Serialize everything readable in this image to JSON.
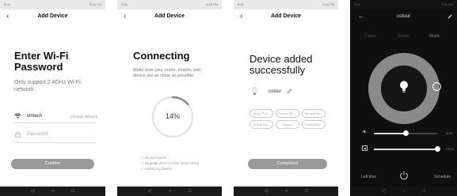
{
  "status_left": "5:26",
  "status_right": "5:26 PM",
  "nav_icons": [
    "◁",
    "○",
    "□"
  ],
  "p1": {
    "title": "Add Device",
    "heading_line1": "Enter Wi-Fi",
    "heading_line2": "Password",
    "note": "Only support 2.4GHz Wi-Fi network",
    "wifi_name": "vintech",
    "change_network": "Change Network",
    "password_placeholder": "Password",
    "password_dots": "···",
    "confirm": "Confirm"
  },
  "p2": {
    "title": "Add Device",
    "heading": "Connecting",
    "note": "Make sure your router, mobile, and device are as close as possible.",
    "progress_text": "14%",
    "progress_value": 0.14,
    "steps": [
      "Device found",
      "Register device to the smart cloud",
      "Initializing device"
    ]
  },
  "p3": {
    "title": "Add Device",
    "heading_line1": "Device added",
    "heading_line2": "successfully",
    "device_name": "colour",
    "rooms": [
      "Living Roo...",
      "Master Be...",
      "Second Be...",
      "Dining Ro...",
      "Kitchen",
      "Study Roo..."
    ],
    "completed": "Completed"
  },
  "p4": {
    "title": "colour",
    "tabs": [
      "Colour",
      "Scene",
      "Music"
    ],
    "brightness_pct": "50%",
    "temp_pct": "100%",
    "brightness_value": 0.5,
    "temp_value": 1.0,
    "left_time": "Left time",
    "schedule": "Schedule"
  },
  "colors": {
    "button_grey": "#9a9a9a",
    "ring_light": "#e6e6e6",
    "dark_bg": "#0f0f0f"
  }
}
